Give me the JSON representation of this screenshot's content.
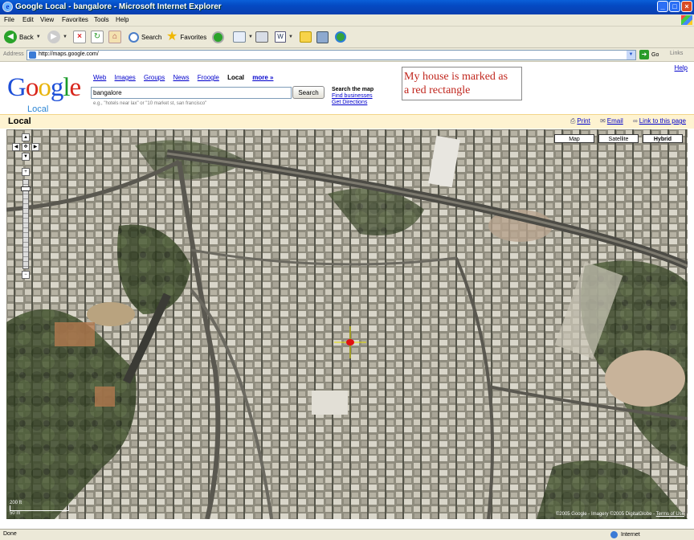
{
  "window": {
    "title": "Google Local - bangalore - Microsoft Internet Explorer",
    "controls": [
      "_",
      "□",
      "×"
    ]
  },
  "menu": {
    "items": [
      "File",
      "Edit",
      "View",
      "Favorites",
      "Tools",
      "Help"
    ]
  },
  "toolbar": {
    "back_label": "Back",
    "search_label": "Search",
    "favorites_label": "Favorites"
  },
  "addressbar": {
    "label": "Address",
    "url": "http://maps.google.com/",
    "go_label": "Go",
    "links_label": "Links"
  },
  "page": {
    "help_link": "Help",
    "logo": {
      "g1": "G",
      "o1": "o",
      "o2": "o",
      "g2": "g",
      "l": "l",
      "e": "e",
      "local": "Local"
    },
    "nav": {
      "web": "Web",
      "images": "Images",
      "groups": "Groups",
      "news": "News",
      "froogle": "Froogle",
      "local": "Local",
      "more": "more »"
    },
    "search": {
      "query": "bangalore",
      "button": "Search",
      "hint": "e.g., \"hotels near lax\" or \"10 market st, san francisco\""
    },
    "side_links": {
      "heading": "Search the map",
      "find": "Find businesses",
      "directions": "Get Directions"
    },
    "annotation": {
      "line1": "My house is marked as",
      "line2": "a red rectangle"
    },
    "section": {
      "label": "Local",
      "print": "Print",
      "email": "Email",
      "link": "Link to this page"
    },
    "map": {
      "types": [
        "Map",
        "Satellite",
        "Hybrid"
      ],
      "selected_type": "Hybrid",
      "scale_top": "200 ft",
      "scale_bottom": "50 m",
      "copyright": "©2005 Google - Imagery ©2005 DigitalGlobe - ",
      "terms": "Terms of Use",
      "zoom_level": 1
    }
  },
  "statusbar": {
    "left": "Done",
    "zone": "Internet"
  }
}
